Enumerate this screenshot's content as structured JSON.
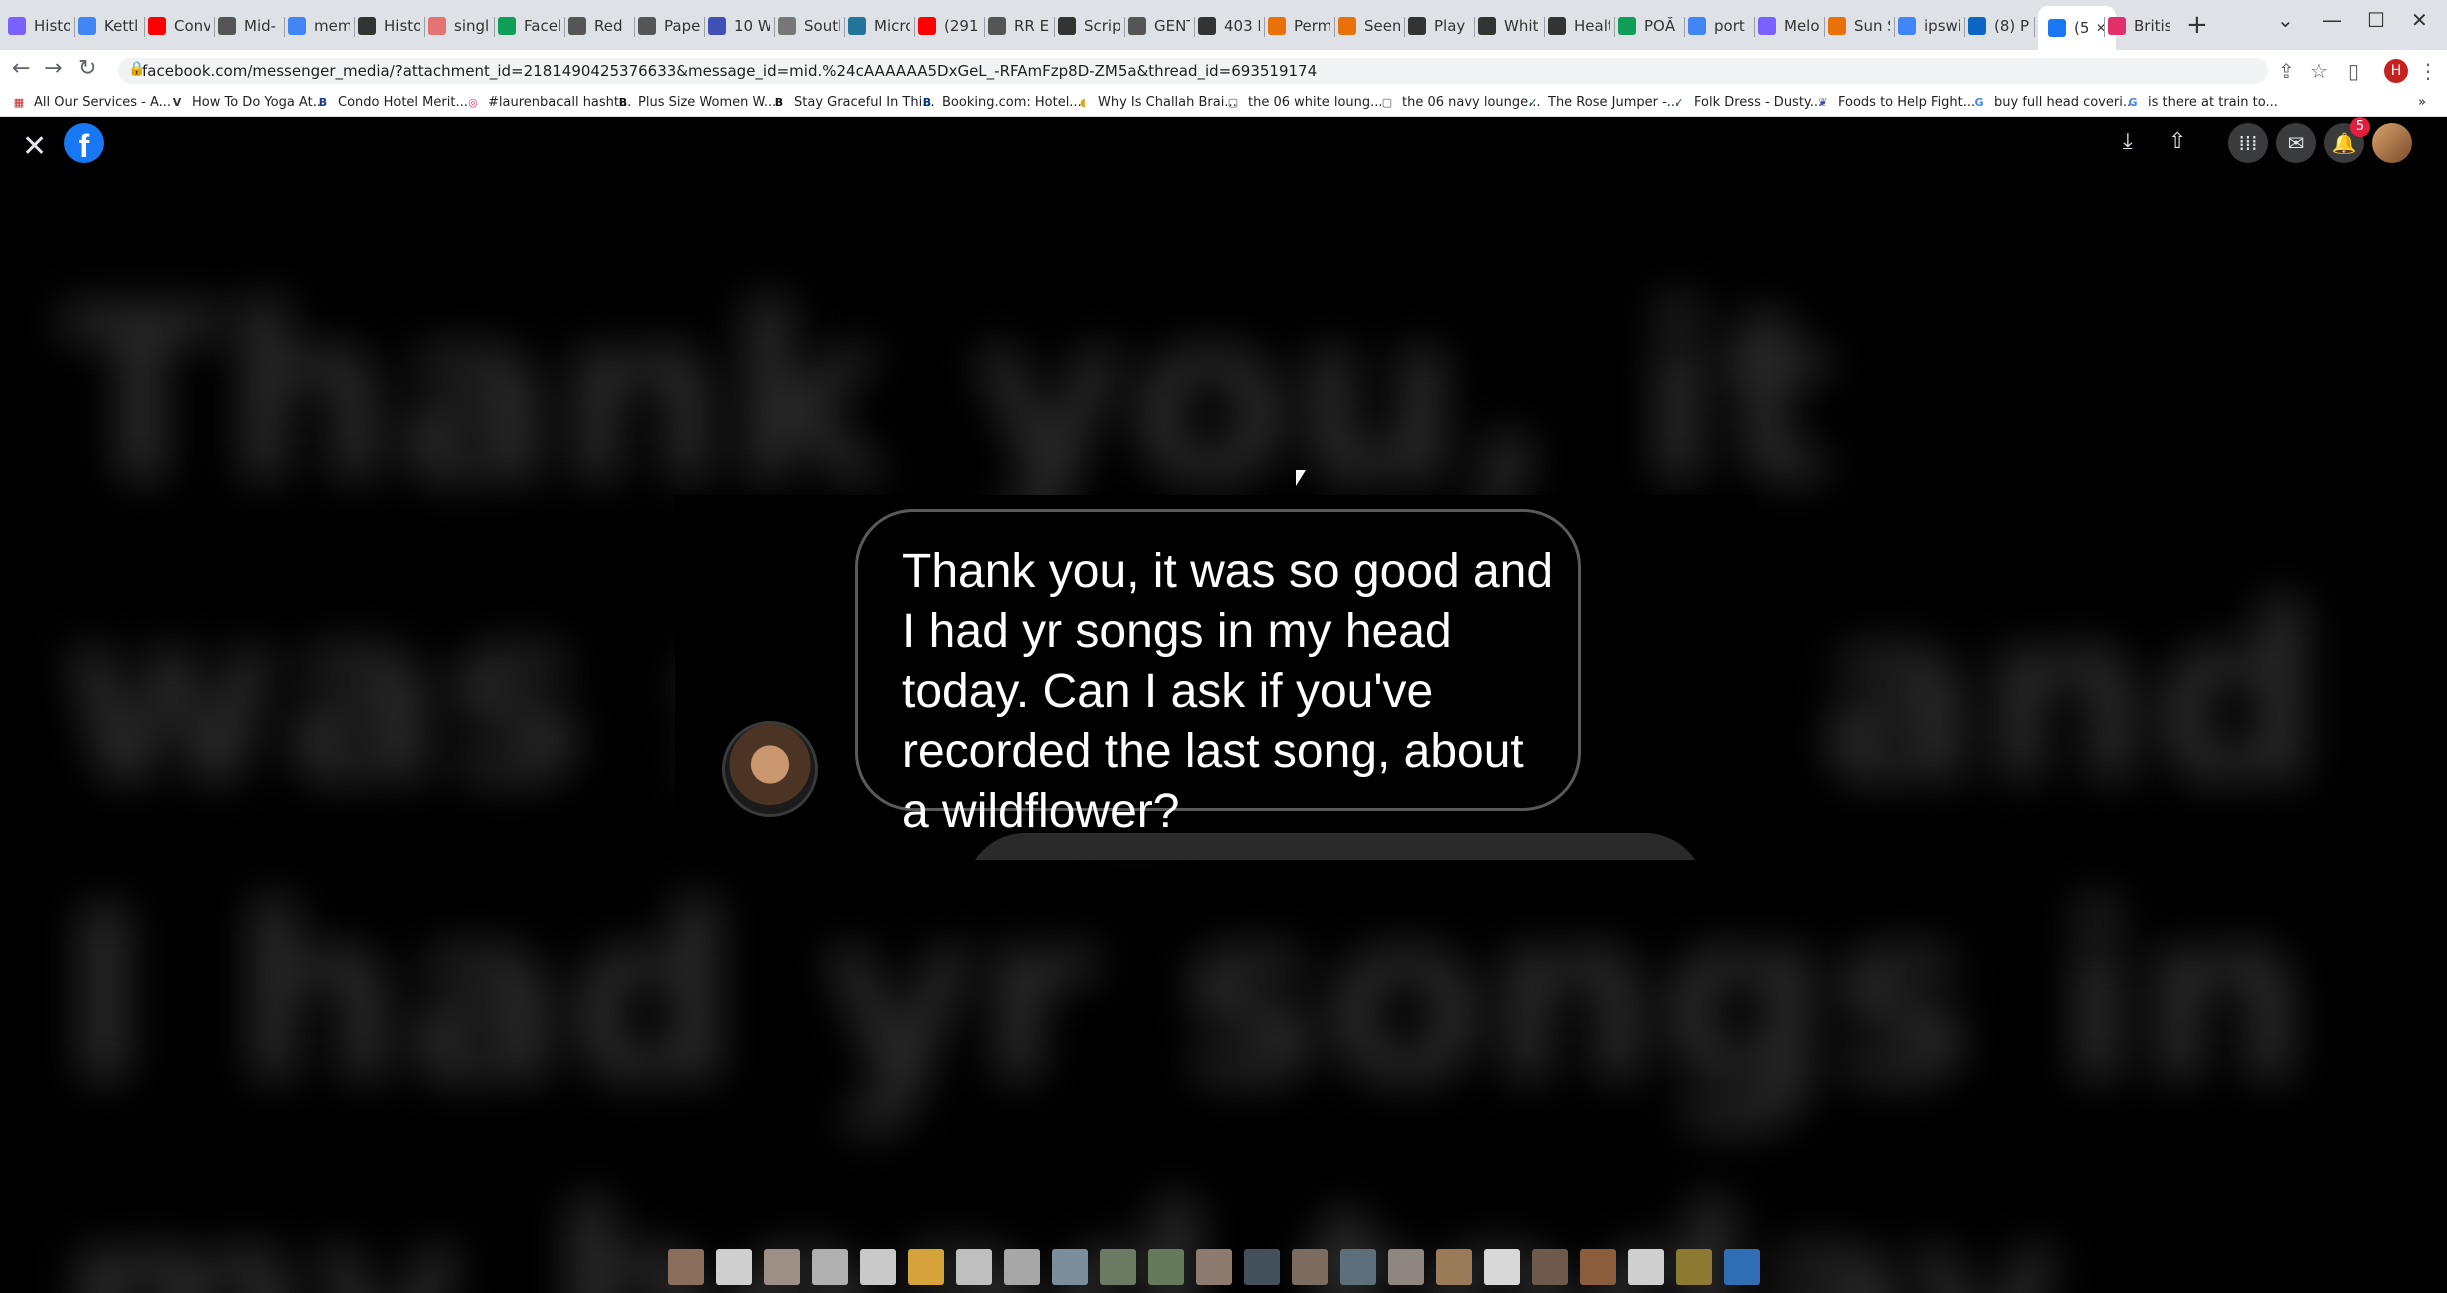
{
  "browser": {
    "tabs": [
      {
        "label": "Histo",
        "color": "#7b61ff"
      },
      {
        "label": "Kettl",
        "color": "#4285f4"
      },
      {
        "label": "Conv",
        "color": "#ff0000"
      },
      {
        "label": "Mid-",
        "color": "#555555"
      },
      {
        "label": "mem",
        "color": "#4285f4"
      },
      {
        "label": "Histo",
        "color": "#333333"
      },
      {
        "label": "singl",
        "color": "#e57373"
      },
      {
        "label": "Facel",
        "color": "#0f9d58"
      },
      {
        "label": "Red",
        "color": "#555555"
      },
      {
        "label": "Pape",
        "color": "#555555"
      },
      {
        "label": "10 W",
        "color": "#3f51b5"
      },
      {
        "label": "South",
        "color": "#777777"
      },
      {
        "label": "Micro",
        "color": "#21759b"
      },
      {
        "label": "(291)",
        "color": "#ff0000"
      },
      {
        "label": "RR E",
        "color": "#555555"
      },
      {
        "label": "Scrip",
        "color": "#333333"
      },
      {
        "label": "GENT",
        "color": "#555555"
      },
      {
        "label": "403 F",
        "color": "#333333"
      },
      {
        "label": "Perm",
        "color": "#e8710a"
      },
      {
        "label": "Seem",
        "color": "#e8710a"
      },
      {
        "label": "Play F",
        "color": "#333333"
      },
      {
        "label": "Whit",
        "color": "#333333"
      },
      {
        "label": "Healt",
        "color": "#333333"
      },
      {
        "label": "POĂ",
        "color": "#0f9d58"
      },
      {
        "label": "port",
        "color": "#4285f4"
      },
      {
        "label": "Melo",
        "color": "#7b61ff"
      },
      {
        "label": "Sun S",
        "color": "#e8710a"
      },
      {
        "label": "ipswi",
        "color": "#4285f4"
      },
      {
        "label": "(8) P",
        "color": "#0a66c2"
      },
      {
        "label": "(5",
        "color": "#1877f2"
      },
      {
        "label": "Britis",
        "color": "#e1306c"
      }
    ],
    "active_tab_index": 29,
    "new_tab": "+",
    "url": "facebook.com/messenger_media/?attachment_id=2181490425376633&message_id=mid.%24cAAAAAA5DxGeL_-RFAmFzp8D-ZM5a&thread_id=693519174",
    "profile_initial": "H",
    "bookmarks": [
      {
        "label": "All Our Services - A...",
        "icon": "calendar-icon",
        "color": "#c5221f"
      },
      {
        "label": "How To Do Yoga At...",
        "icon": "v-icon",
        "color": "#333333"
      },
      {
        "label": "Condo Hotel Merit...",
        "icon": "b-icon",
        "color": "#1a3d8f"
      },
      {
        "label": "#laurenbacall hasht...",
        "icon": "instagram-icon",
        "color": "#e1306c"
      },
      {
        "label": "Plus Size Women W...",
        "icon": "b-icon",
        "color": "#111111"
      },
      {
        "label": "Stay Graceful In Thi...",
        "icon": "b-icon",
        "color": "#111111"
      },
      {
        "label": "Booking.com: Hotel...",
        "icon": "b-icon",
        "color": "#003580"
      },
      {
        "label": "Why Is Challah Brai...",
        "icon": "bread-icon",
        "color": "#e8a317"
      },
      {
        "label": "the 06 white loung...",
        "icon": "page-icon",
        "color": "#555555"
      },
      {
        "label": "the 06 navy lounge...",
        "icon": "page-icon",
        "color": "#555555"
      },
      {
        "label": "The Rose Jumper -...",
        "icon": "check-icon",
        "color": "#0f5132"
      },
      {
        "label": "Folk Dress - Dusty...",
        "icon": "check-icon",
        "color": "#0f5132"
      },
      {
        "label": "Foods to Help Fight...",
        "icon": "leaf-icon",
        "color": "#3f51b5"
      },
      {
        "label": "buy full head coveri...",
        "icon": "google-icon",
        "color": "#4285f4"
      },
      {
        "label": "is there at train to...",
        "icon": "google-icon",
        "color": "#4285f4"
      }
    ]
  },
  "viewer": {
    "notification_count": "5",
    "background_blur_text": "Thank you, it was so good and I had yr songs in my head today. Can I ask if you've recorded the last song, about a wildflower?",
    "message": "Thank you, it was so good and I had yr songs in my head today. Can I ask if you've recorded the last song, about a wildflower?",
    "thumbnail_count": 23
  }
}
